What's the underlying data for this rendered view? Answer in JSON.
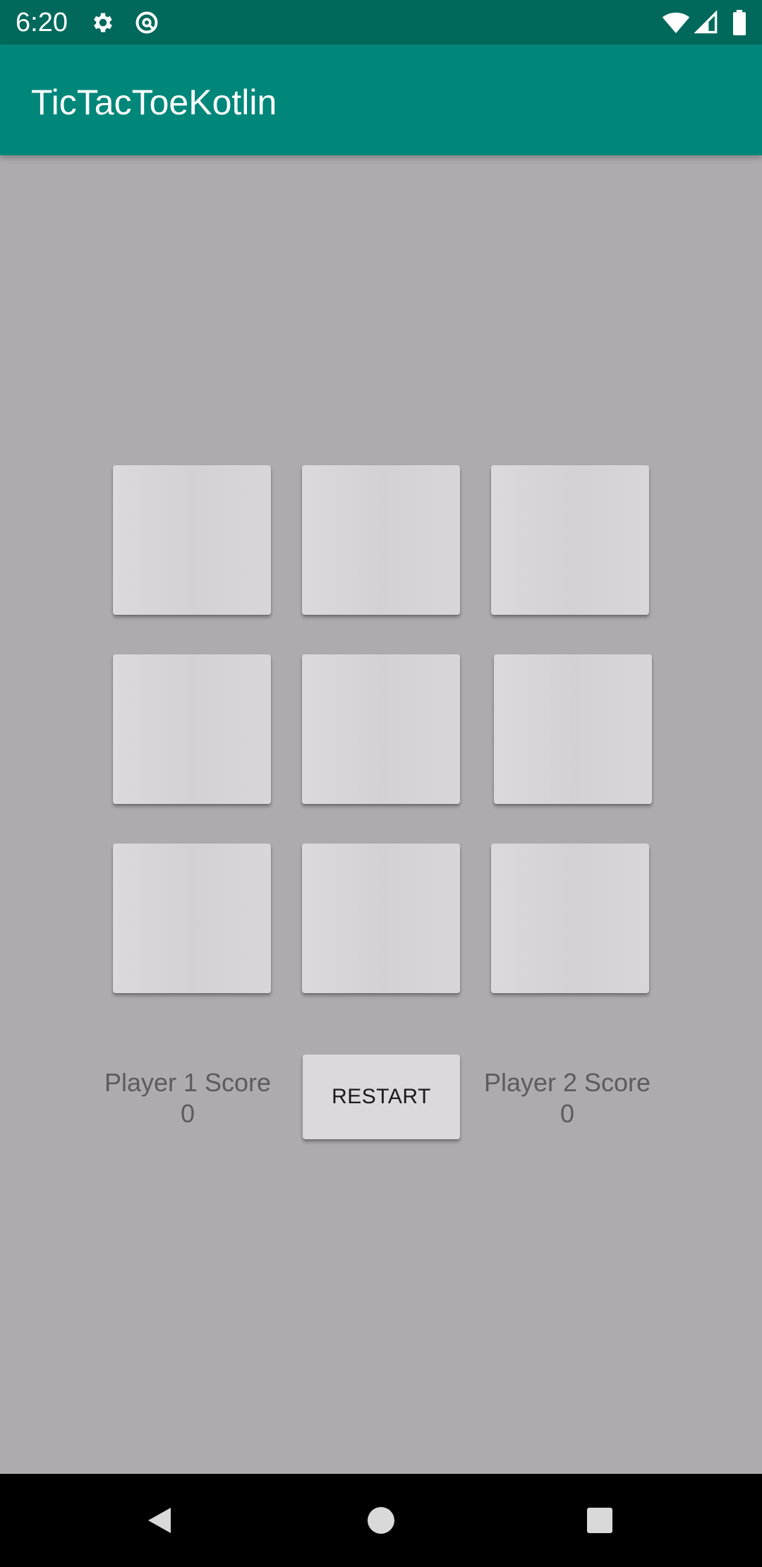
{
  "status_bar": {
    "time": "6:20",
    "left_icons": [
      "gear-icon",
      "sync-icon"
    ],
    "right_icons": [
      "wifi-icon",
      "signal-icon",
      "battery-icon"
    ]
  },
  "app_bar": {
    "title": "TicTacToeKotlin"
  },
  "board": {
    "cells": [
      "",
      "",
      "",
      "",
      "",
      "",
      "",
      "",
      ""
    ]
  },
  "scores": {
    "player1": {
      "label": "Player 1 Score",
      "value": "0"
    },
    "player2": {
      "label": "Player 2 Score",
      "value": "0"
    }
  },
  "restart": {
    "label": "RESTART"
  },
  "nav_bar": {
    "icons": [
      "back-icon",
      "home-icon",
      "recents-icon"
    ]
  },
  "colors": {
    "status_bar": "#00695c",
    "app_bar": "#00877a",
    "background": "#aeaaae",
    "cell": "#dcd9dc"
  }
}
